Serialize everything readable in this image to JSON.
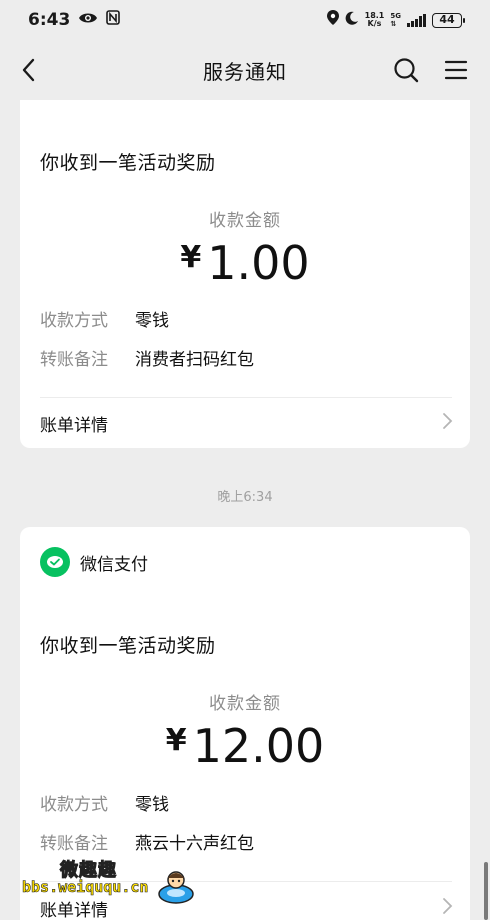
{
  "status_bar": {
    "time": "6:43",
    "speed_value": "18.1",
    "speed_unit": "K/s",
    "network": "5G",
    "battery": "44"
  },
  "nav": {
    "title": "服务通知",
    "back_icon": "chevron-left-icon",
    "search_icon": "search-icon",
    "menu_icon": "menu-icon"
  },
  "notifications": [
    {
      "title": "你收到一笔活动奖励",
      "amount_label": "收款金额",
      "currency": "¥",
      "amount": "1.00",
      "method_label": "收款方式",
      "method_value": "零钱",
      "note_label": "转账备注",
      "note_value": "消费者扫码红包",
      "details_label": "账单详情"
    },
    {
      "header": "微信支付",
      "title": "你收到一笔活动奖励",
      "amount_label": "收款金额",
      "currency": "¥",
      "amount": "12.00",
      "method_label": "收款方式",
      "method_value": "零钱",
      "note_label": "转账备注",
      "note_value": "燕云十六声红包",
      "details_label": "账单详情"
    }
  ],
  "timestamp": "晚上6:34",
  "watermark": {
    "line1": "微趣趣",
    "url": "bbs.weiququ.cn"
  },
  "colors": {
    "background": "#ededed",
    "card": "#ffffff",
    "wechat_green": "#07c160",
    "label_gray": "#8c8c8c"
  }
}
